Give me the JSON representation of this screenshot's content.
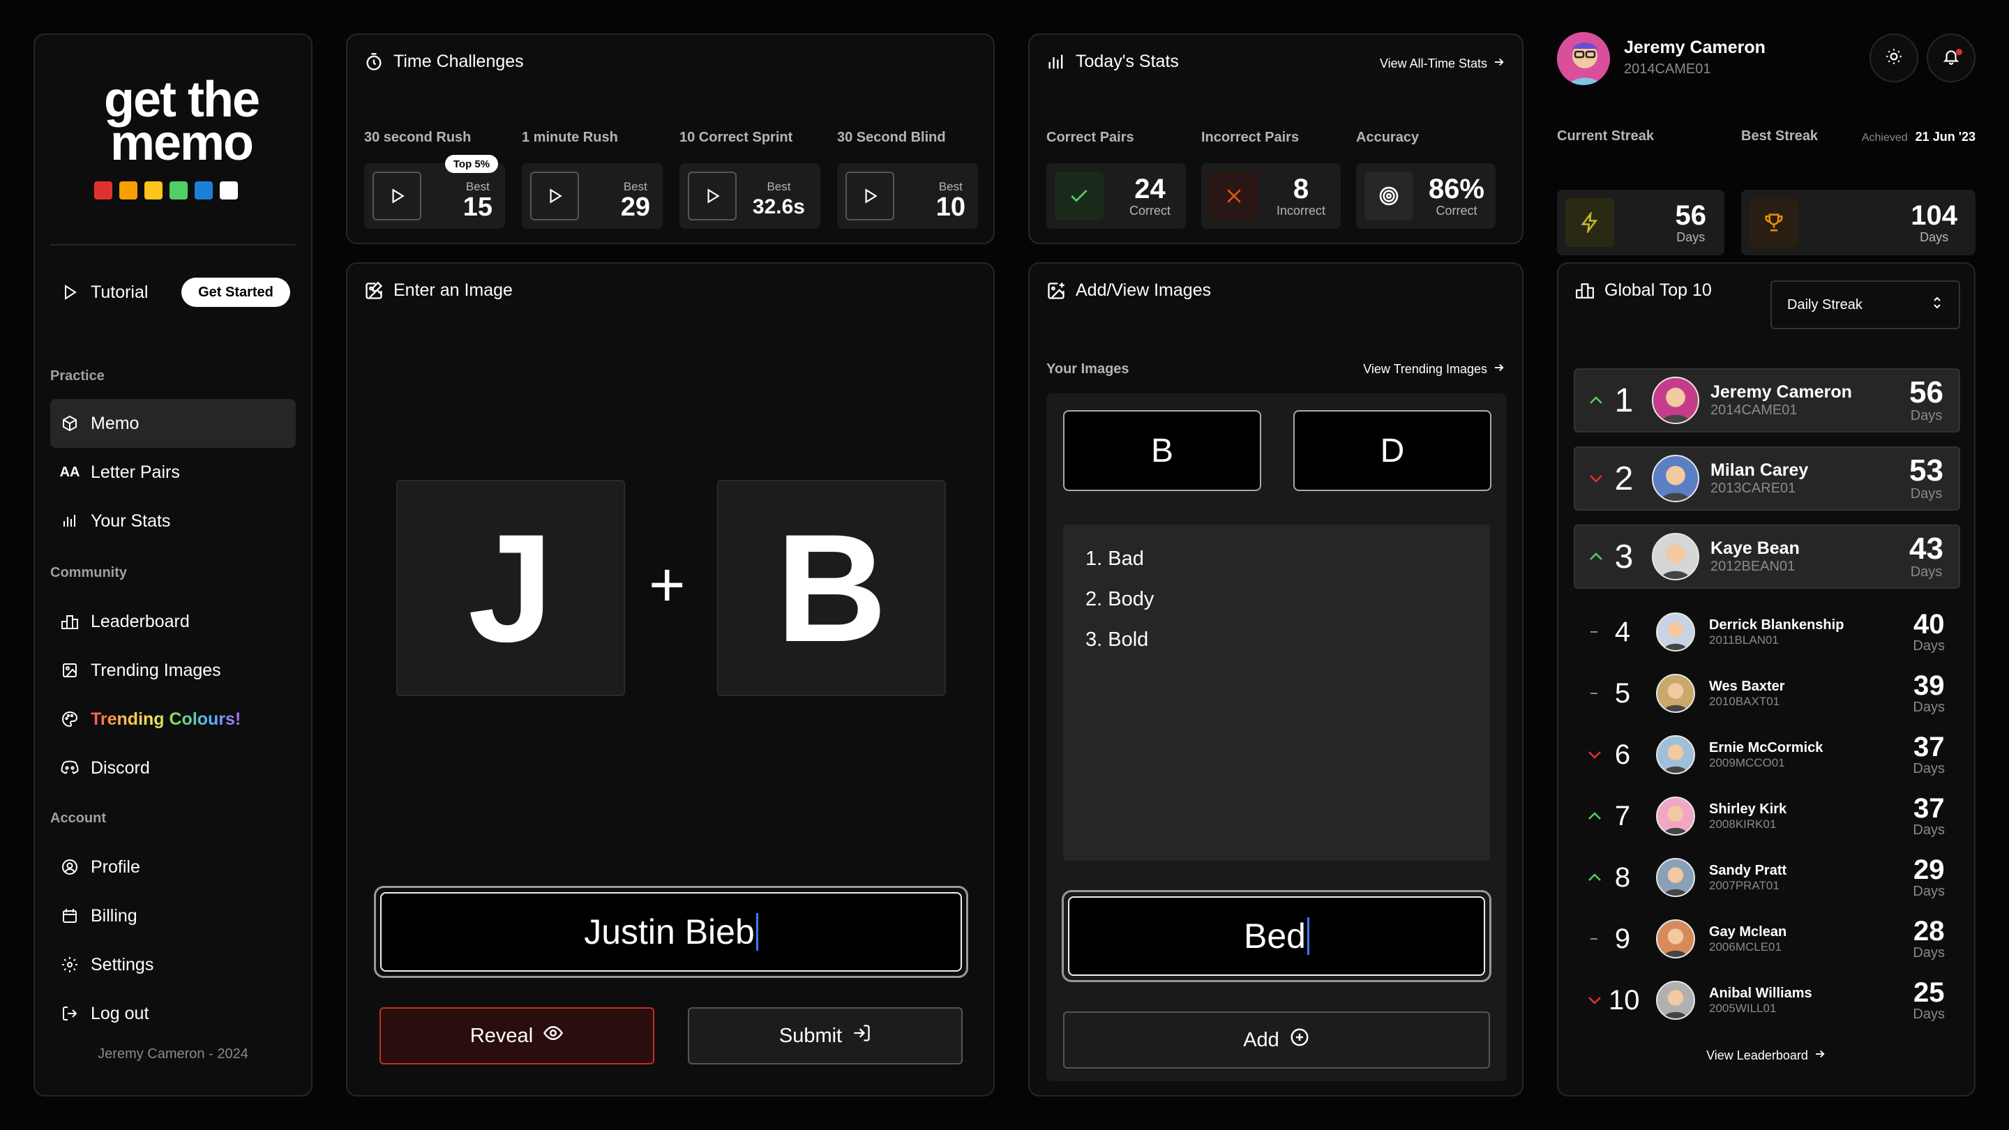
{
  "sidebar": {
    "logo": {
      "line1": "get the",
      "line2": "memo",
      "colors": [
        "#e03131",
        "#f59f00",
        "#fcc419",
        "#51cf66",
        "#1c7ed6",
        "#ffffff"
      ]
    },
    "tutorial_label": "Tutorial",
    "get_started_label": "Get Started",
    "sections": {
      "practice": "Practice",
      "community": "Community",
      "account": "Account"
    },
    "practice_items": [
      "Memo",
      "Letter Pairs",
      "Your Stats"
    ],
    "community_items": [
      "Leaderboard",
      "Trending Images",
      "Trending Colours!",
      "Discord"
    ],
    "account_items": [
      "Profile",
      "Billing",
      "Settings",
      "Log out"
    ],
    "footer": "Jeremy Cameron - 2024"
  },
  "time_challenges": {
    "title": "Time Challenges",
    "badge": "Top 5%",
    "best_label": "Best",
    "items": [
      {
        "label": "30 second Rush",
        "best": "15"
      },
      {
        "label": "1 minute Rush",
        "best": "29"
      },
      {
        "label": "10 Correct Sprint",
        "best": "32.6s"
      },
      {
        "label": "30 Second Blind",
        "best": "10"
      }
    ]
  },
  "todays_stats": {
    "title": "Today's Stats",
    "link": "View All-Time Stats",
    "items": [
      {
        "label": "Correct Pairs",
        "value": "24",
        "sub": "Correct"
      },
      {
        "label": "Incorrect Pairs",
        "value": "8",
        "sub": "Incorrect"
      },
      {
        "label": "Accuracy",
        "value": "86%",
        "sub": "Correct"
      }
    ]
  },
  "profile": {
    "name": "Jeremy Cameron",
    "id": "2014CAME01",
    "current_streak_label": "Current Streak",
    "current_streak": "56",
    "best_streak_label": "Best Streak",
    "best_streak": "104",
    "days_label": "Days",
    "achieved_label": "Achieved",
    "achieved_date": "21 Jun '23"
  },
  "enter_image": {
    "title": "Enter an Image",
    "letter1": "J",
    "letter2": "B",
    "plus": "+",
    "input_value": "Justin Bieb",
    "reveal_label": "Reveal",
    "submit_label": "Submit"
  },
  "add_view": {
    "title": "Add/View Images",
    "your_images_label": "Your Images",
    "link": "View Trending Images",
    "pair": [
      "B",
      "D"
    ],
    "list": [
      "1. Bad",
      "2. Body",
      "3. Bold"
    ],
    "input_value": "Bed",
    "add_label": "Add"
  },
  "global_top": {
    "title": "Global Top 10",
    "select_value": "Daily Streak",
    "link": "View Leaderboard",
    "days_label": "Days",
    "rows": [
      {
        "rank": "1",
        "trend": "up",
        "name": "Jeremy Cameron",
        "id": "2014CAME01",
        "days": "56",
        "avatar": "#c43d8a"
      },
      {
        "rank": "2",
        "trend": "down",
        "name": "Milan Carey",
        "id": "2013CARE01",
        "days": "53",
        "avatar": "#5a7fc4"
      },
      {
        "rank": "3",
        "trend": "up",
        "name": "Kaye Bean",
        "id": "2012BEAN01",
        "days": "43",
        "avatar": "#d6d6d6"
      },
      {
        "rank": "4",
        "trend": "same",
        "name": "Derrick Blankenship",
        "id": "2011BLAN01",
        "days": "40",
        "avatar": "#c8d4e6"
      },
      {
        "rank": "5",
        "trend": "same",
        "name": "Wes Baxter",
        "id": "2010BAXT01",
        "days": "39",
        "avatar": "#c9a86a"
      },
      {
        "rank": "6",
        "trend": "down",
        "name": "Ernie McCormick",
        "id": "2009MCCO01",
        "days": "37",
        "avatar": "#9fc0d8"
      },
      {
        "rank": "7",
        "trend": "up",
        "name": "Shirley Kirk",
        "id": "2008KIRK01",
        "days": "37",
        "avatar": "#f2a6c6"
      },
      {
        "rank": "8",
        "trend": "up",
        "name": "Sandy Pratt",
        "id": "2007PRAT01",
        "days": "29",
        "avatar": "#8aa0b8"
      },
      {
        "rank": "9",
        "trend": "same",
        "name": "Gay Mclean",
        "id": "2006MCLE01",
        "days": "28",
        "avatar": "#d88a5a"
      },
      {
        "rank": "10",
        "trend": "down",
        "name": "Anibal Williams",
        "id": "2005WILL01",
        "days": "25",
        "avatar": "#b0b0b0"
      }
    ]
  },
  "icons": [
    "play-icon",
    "timer-icon",
    "chart-icon",
    "check-icon",
    "x-icon",
    "target-icon",
    "bolt-icon",
    "trophy-icon",
    "sun-icon",
    "bell-icon",
    "image-edit-icon",
    "eye-icon",
    "submit-icon",
    "plus-circle-icon",
    "leaderboard-icon",
    "chevron-updown-icon",
    "arrow-right-icon"
  ],
  "colors": {
    "accent_red": "#c92a2a",
    "up_green": "#51cf66",
    "down_red": "#e03131",
    "caret_blue": "#3d7cff"
  }
}
